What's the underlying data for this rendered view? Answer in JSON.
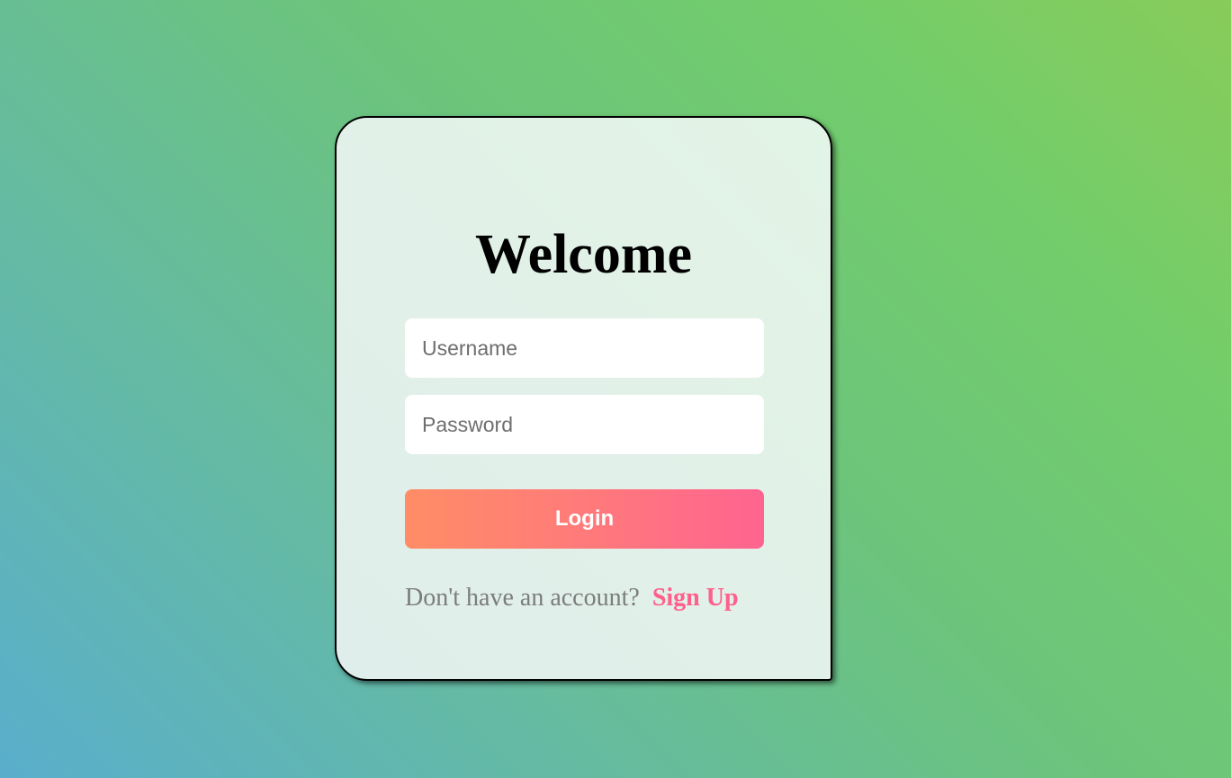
{
  "login_card": {
    "title": "Welcome",
    "username_placeholder": "Username",
    "password_placeholder": "Password",
    "login_label": "Login",
    "signup_prompt": "Don't have an account?",
    "signup_link": "Sign Up"
  },
  "colors": {
    "accent_start": "#ff8d66",
    "accent_end": "#ff6490",
    "link": "#ff5f8a"
  }
}
